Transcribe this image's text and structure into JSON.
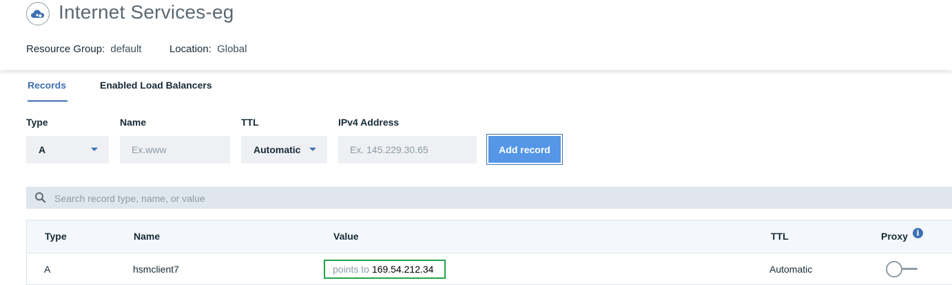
{
  "header": {
    "title": "Internet Services-eg",
    "icon": "cloud-service-icon",
    "resource_group_label": "Resource Group:",
    "resource_group_value": "default",
    "location_label": "Location:",
    "location_value": "Global"
  },
  "tabs": [
    {
      "label": "Records",
      "active": true
    },
    {
      "label": "Enabled Load Balancers",
      "active": false
    }
  ],
  "form": {
    "type_label": "Type",
    "type_value": "A",
    "name_label": "Name",
    "name_placeholder": "Ex.www",
    "ttl_label": "TTL",
    "ttl_value": "Automatic",
    "ipv4_label": "IPv4 Address",
    "ipv4_placeholder": "Ex. 145.229.30.65",
    "add_button": "Add record"
  },
  "search": {
    "placeholder": "Search record type, name, or value"
  },
  "table": {
    "columns": [
      "Type",
      "Name",
      "Value",
      "TTL",
      "Proxy"
    ],
    "rows": [
      {
        "type": "A",
        "name": "hsmclient7",
        "value_prefix": "points to",
        "value": "169.54.212.34",
        "ttl": "Automatic",
        "proxy": "off"
      }
    ]
  },
  "colors": {
    "accent": "#3d70b2",
    "button": "#5596e6",
    "highlight": "#22a348"
  }
}
